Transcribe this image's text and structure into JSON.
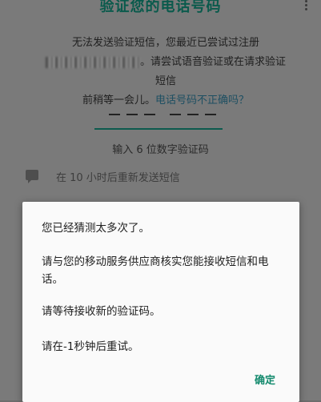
{
  "header": {
    "title": "验证您的电话号码",
    "menu_icon": "more-vert-icon"
  },
  "description": {
    "line1": "无法发送验证短信，您最近已尝试过注册",
    "line2_suffix": "。请尝试语音验证或在请求验证短信",
    "line3_prefix": "前稍等一会儿。",
    "wrong_number_link": "电话号码不正确吗？"
  },
  "code_input": {
    "placeholder_groups": [
      "— — —",
      "— — —"
    ]
  },
  "hint": "输入 6 位数字验证码",
  "resend": {
    "icon": "message-icon",
    "label": "在 10 小时后重新发送短信"
  },
  "dialog": {
    "message1": "您已经猜测太多次了。",
    "message2": "请与您的移动服务供应商核实您能接收短信和电话。",
    "message3": "请等待接收新的验证码。",
    "message4": "请在-1秒钟后重试。",
    "ok_label": "确定"
  }
}
